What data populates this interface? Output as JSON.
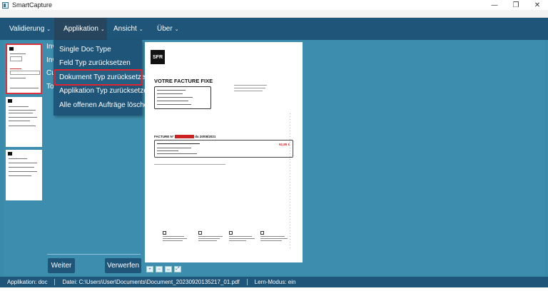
{
  "window": {
    "title": "SmartCapture",
    "controls": [
      "—",
      "❐",
      "✕"
    ]
  },
  "menubar": {
    "items": [
      {
        "label": "Validierung",
        "chevron": "⌄"
      },
      {
        "label": "Applikation",
        "chevron": "⌄"
      },
      {
        "label": "Ansicht",
        "chevron": "⌄"
      },
      {
        "label": "Über",
        "chevron": "⌄"
      }
    ]
  },
  "dropdown": {
    "items": [
      {
        "label": "Single Doc Type"
      },
      {
        "label": "Feld Typ zurücksetzen"
      },
      {
        "label": "Dokument Typ zurücksetzen",
        "highlighted": true
      },
      {
        "label": "Applikation Typ zurücksetzen"
      },
      {
        "label": "Alle offenen Aufträge löschen"
      }
    ]
  },
  "fields": {
    "labels": [
      "Inv",
      "Inv",
      "Cu",
      "Tot"
    ]
  },
  "buttons": {
    "weiter": "Weiter",
    "verwerfen": "Verwerfen"
  },
  "document": {
    "logo": "SFR",
    "title": "VOTRE FACTURE FIXE",
    "facture_prefix": "FACTURE N°",
    "facture_number": "XXXXXXXXX",
    "facture_suffix": " du 20/08/2021",
    "amount": "52,85 €"
  },
  "viewer_tools": [
    "icon-zoom-in",
    "icon-zoom-out",
    "icon-fit-width",
    "icon-fit-page"
  ],
  "statusbar": {
    "application": "Applikation: doc",
    "file": "Datei: C:\\Users\\User\\Documents\\Document_20230920135217_01.pdf",
    "learn_mode": "Lern-Modus: ein"
  },
  "colors": {
    "menubar": "#1f5578",
    "panel": "#3d8dae",
    "highlight": "#e0242f"
  }
}
